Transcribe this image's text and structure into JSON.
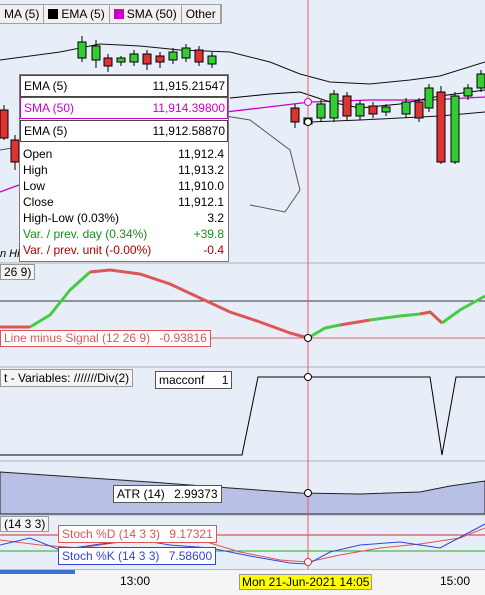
{
  "legend": {
    "items": [
      {
        "label": "MA (5)",
        "color": "#000000",
        "swatch": false
      },
      {
        "label": "EMA (5)",
        "color": "#000000",
        "swatch": true
      },
      {
        "label": "SMA (50)",
        "color": "#cc00cc",
        "swatch": true
      },
      {
        "label": "Other",
        "color": "#000000",
        "swatch": false
      }
    ]
  },
  "tooltip": {
    "ema_top": {
      "label": "EMA (5)",
      "value": "11,915.21547"
    },
    "sma": {
      "label": "SMA (50)",
      "value": "11,914.39800"
    },
    "ema_bottom": {
      "label": "EMA (5)",
      "value": "11,912.58870"
    },
    "rows": [
      {
        "label": "Open",
        "value": "11,912.4",
        "color": "#000000"
      },
      {
        "label": "High",
        "value": "11,913.2",
        "color": "#000000"
      },
      {
        "label": "Low",
        "value": "11,910.0",
        "color": "#000000"
      },
      {
        "label": "Close",
        "value": "11,912.1",
        "color": "#000000"
      },
      {
        "label": "High-Low (0.03%)",
        "value": "3.2",
        "color": "#000000"
      },
      {
        "label": "Var. / prev. day (0.34%)",
        "value": "+39.8",
        "color": "#1a8c1a"
      },
      {
        "label": "Var. / prev. unit (-0.00%)",
        "value": "-0.4",
        "color": "#b00000"
      }
    ]
  },
  "macd_panel": {
    "title_fragment": "26 9)",
    "signal_label": "Line minus Signal (12 26 9)",
    "signal_value": "-0.93816"
  },
  "variables_panel": {
    "title": "t - Variables: ///////Div(2)",
    "tag_label": "macconf",
    "tag_value": "1"
  },
  "atr_panel": {
    "label": "ATR (14)",
    "value": "2.99373"
  },
  "stoch_panel": {
    "title_fragment": "(14 3 3)",
    "d_label": "Stoch %D (14 3 3)",
    "d_value": "9.17321",
    "k_label": "Stoch %K (14 3 3)",
    "k_value": "7.58600"
  },
  "xaxis": {
    "ticks": [
      "13:00",
      "15:00"
    ],
    "cursor_label": "Mon 21-Jun-2021 14:05"
  },
  "colors": {
    "bull": "#33cc33",
    "bear": "#dd3333",
    "sma": "#cc00cc",
    "macd_up": "#44cc44",
    "macd_down": "#dd5555",
    "stoch_d": "#dd5555",
    "stoch_k": "#3344dd",
    "cursor": "#e06060"
  },
  "cursor_hint": "n Hi"
}
